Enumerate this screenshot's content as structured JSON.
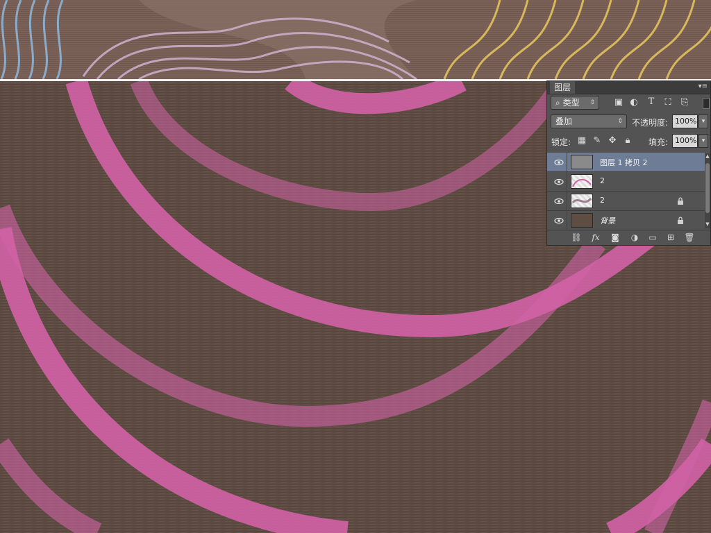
{
  "layers_panel": {
    "tab_title": "图层",
    "filter": {
      "kind_label": "类型",
      "icons": [
        "image-filter-icon",
        "adjustment-filter-icon",
        "type-filter-icon",
        "shape-filter-icon",
        "smart-object-filter-icon"
      ]
    },
    "blend_mode": "叠加",
    "opacity_label": "不透明度:",
    "opacity_value": "100%",
    "lock_label": "锁定:",
    "lock_icons": [
      "lock-pixels-icon",
      "lock-paint-icon",
      "lock-position-icon",
      "lock-all-icon"
    ],
    "fill_label": "填充:",
    "fill_value": "100%",
    "layers": [
      {
        "name": "图层 1 拷贝 2",
        "selected": true,
        "visible": true,
        "locked": false,
        "thumb": "gray"
      },
      {
        "name": "2",
        "selected": false,
        "visible": true,
        "locked": false,
        "thumb": "pattern-pink"
      },
      {
        "name": "2",
        "selected": false,
        "visible": true,
        "locked": true,
        "thumb": "pattern-mauve"
      },
      {
        "name": "背景",
        "selected": false,
        "visible": true,
        "locked": true,
        "thumb": "brown"
      }
    ],
    "footer_icons": [
      "link-layers-icon",
      "fx-icon",
      "add-mask-icon",
      "adjustment-layer-icon",
      "new-group-icon",
      "new-layer-icon",
      "delete-layer-icon"
    ],
    "fx_label": "fx"
  },
  "canvas": {
    "background_color": "#5e4d43",
    "stripe_color": "#d262a6",
    "top_strip": {
      "left_wave_color": "#8fb3d6",
      "mid_wave_color": "#cfb2cf",
      "right_wave_color": "#e3c25d"
    }
  }
}
